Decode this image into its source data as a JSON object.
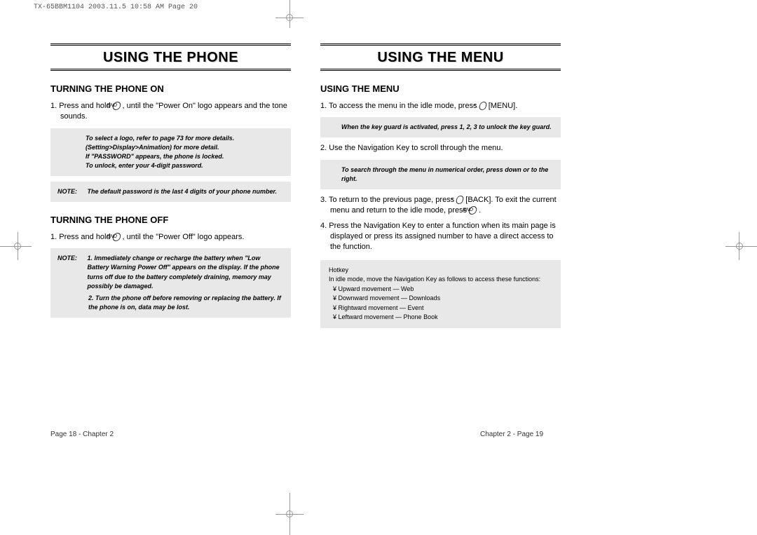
{
  "print_header": "TX-65BBM1104  2003.11.5  10:58 AM  Page 20",
  "left_page": {
    "chapter_title": "USING THE PHONE",
    "section1_heading": "TURNING THE PHONE ON",
    "section1_step1_a": "1. Press and hold ",
    "section1_step1_b": " , until the \"Power On\" logo appears and the tone sounds.",
    "note1_line1": "To select a logo, refer to page 73 for more details. (Setting>Display>Animation) for more detail.",
    "note1_line2": "If \"PASSWORD\" appears, the phone is locked.",
    "note1_line3": "To unlock, enter your 4-digit password.",
    "note1b_label": "NOTE:",
    "note1b_body": "The default password is the last 4 digits of your phone number.",
    "section2_heading": "TURNING THE PHONE OFF",
    "section2_step1_a": "1. Press and hold ",
    "section2_step1_b": " , until the \"Power Off\" logo appears.",
    "note2_label": "NOTE:",
    "note2_item1": "1. Immediately change or recharge the battery when \"Low Battery Warning Power Off\" appears on the display. If the phone turns off due to the battery completely draining, memory may possibly be damaged.",
    "note2_item2": "2. Turn the phone off before removing or replacing the battery. If the phone is on, data may be lost.",
    "footer": "Page 18 - Chapter 2"
  },
  "right_page": {
    "chapter_title": "USING THE MENU",
    "section1_heading": "USING THE MENU",
    "step1_a": "1. To access the menu in the idle mode, press ",
    "step1_b": " [MENU].",
    "note1": "When the key guard is activated, press 1, 2, 3 to unlock the key guard.",
    "step2": "2. Use the Navigation Key to scroll through the menu.",
    "note2": "To search through the menu in numerical order, press down or to the right.",
    "step3_a": "3. To return to the previous page, press ",
    "step3_b": " [BACK]. To exit the current menu and return to the idle mode, press ",
    "step3_c": " .",
    "step4": "4. Press the Navigation Key to enter a function when its main page is displayed or press its assigned number to have a direct access to the function.",
    "hotkey_title": "Hotkey",
    "hotkey_intro": "In idle mode, move the Navigation Key as follows to access these functions:",
    "hotkey_1": "¥ Upward movement — Web",
    "hotkey_2": "¥ Downward movement — Downloads",
    "hotkey_3": "¥ Rightward movement — Event",
    "hotkey_4": "¥ Leftward movement — Phone Book",
    "footer": "Chapter 2 - Page 19"
  }
}
